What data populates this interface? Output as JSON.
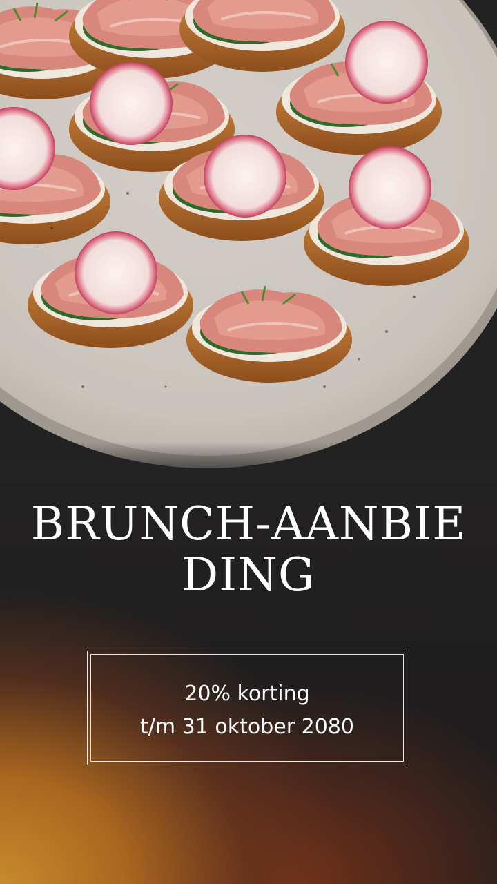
{
  "headline": "BRUNCH-AANBIEDING",
  "offer": {
    "discount": "20% korting",
    "valid_until": "t/m 31 oktober 2080"
  },
  "colors": {
    "text": "#ffffff",
    "frame": "#efe8e2",
    "background_dark": "#232222",
    "glow_orange": "#c78a2c"
  }
}
